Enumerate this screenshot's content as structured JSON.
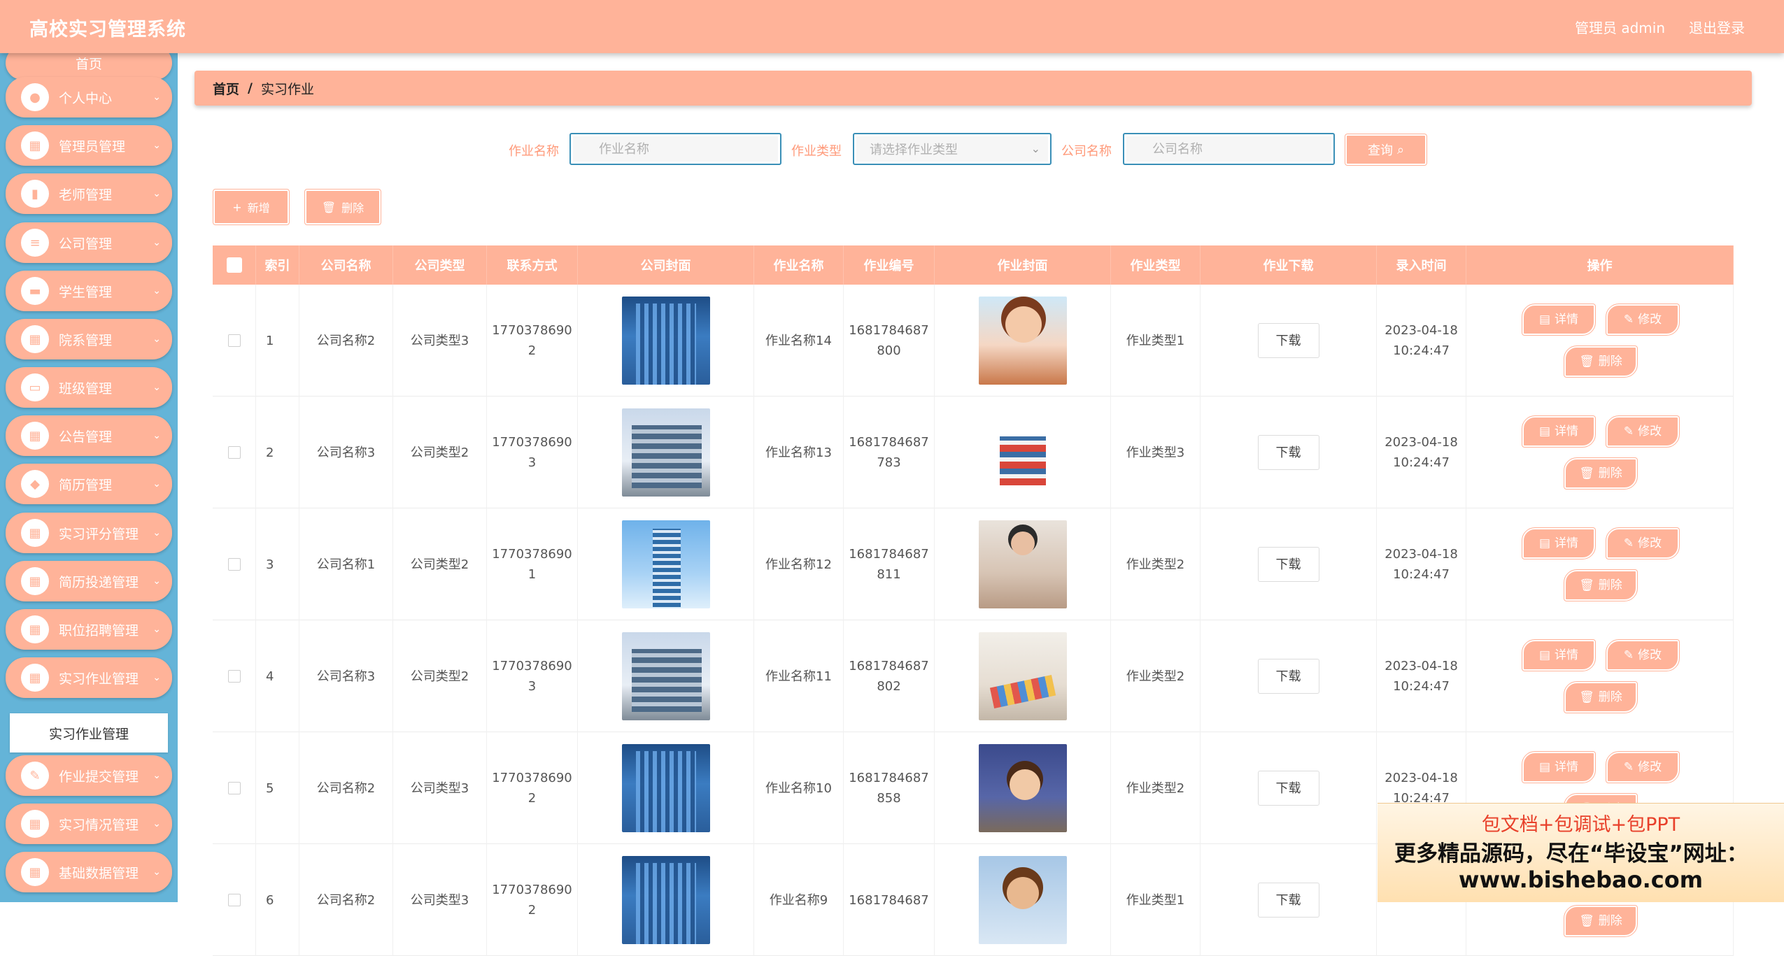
{
  "header": {
    "title": "高校实习管理系统",
    "user_label": "管理员 admin",
    "logout_label": "退出登录"
  },
  "sidebar": {
    "home_label": "首页",
    "items": [
      {
        "label": "个人中心",
        "icon": "person-icon"
      },
      {
        "label": "管理员管理",
        "icon": "grid-icon"
      },
      {
        "label": "老师管理",
        "icon": "bar-chart-icon"
      },
      {
        "label": "公司管理",
        "icon": "list-icon"
      },
      {
        "label": "学生管理",
        "icon": "sofa-icon"
      },
      {
        "label": "院系管理",
        "icon": "grid-icon"
      },
      {
        "label": "班级管理",
        "icon": "chat-icon"
      },
      {
        "label": "公告管理",
        "icon": "grid-icon"
      },
      {
        "label": "简历管理",
        "icon": "leaf-icon"
      },
      {
        "label": "实习评分管理",
        "icon": "grid-icon"
      },
      {
        "label": "简历投递管理",
        "icon": "grid-icon"
      },
      {
        "label": "职位招聘管理",
        "icon": "grid-icon"
      },
      {
        "label": "实习作业管理",
        "icon": "grid-icon"
      },
      {
        "label": "作业提交管理",
        "icon": "edit-icon"
      },
      {
        "label": "实习情况管理",
        "icon": "grid-icon"
      },
      {
        "label": "基础数据管理",
        "icon": "grid-icon"
      }
    ],
    "submenu_label": "实习作业管理"
  },
  "breadcrumb": {
    "home": "首页",
    "separator": "/",
    "current": "实习作业"
  },
  "search": {
    "homework_name_label": "作业名称",
    "homework_name_placeholder": "作业名称",
    "homework_type_label": "作业类型",
    "homework_type_placeholder": "请选择作业类型",
    "company_name_label": "公司名称",
    "company_name_placeholder": "公司名称",
    "query_label": "查询"
  },
  "actions": {
    "add_label": "新增",
    "delete_label": "删除"
  },
  "table": {
    "columns": [
      "索引",
      "公司名称",
      "公司类型",
      "联系方式",
      "公司封面",
      "作业名称",
      "作业编号",
      "作业封面",
      "作业类型",
      "作业下载",
      "录入时间",
      "操作"
    ],
    "download_label": "下载",
    "detail_label": "详情",
    "edit_label": "修改",
    "delete_label": "删除",
    "rows": [
      {
        "index": "1",
        "company": "公司名称2",
        "ctype": "公司类型3",
        "phone": "17703786902",
        "phone_a": "1770378690",
        "phone_b": "2",
        "cover": "building-a",
        "hw_name": "作业名称14",
        "hw_no_a": "1681784687",
        "hw_no_b": "800",
        "hw_cover": "hw1",
        "hw_type": "作业类型1",
        "date": "2023-04-18",
        "time": "10:24:47"
      },
      {
        "index": "2",
        "company": "公司名称3",
        "ctype": "公司类型2",
        "phone": "17703786903",
        "phone_a": "1770378690",
        "phone_b": "3",
        "cover": "building-b",
        "hw_name": "作业名称13",
        "hw_no_a": "1681784687",
        "hw_no_b": "783",
        "hw_cover": "hw2",
        "hw_type": "作业类型3",
        "date": "2023-04-18",
        "time": "10:24:47"
      },
      {
        "index": "3",
        "company": "公司名称1",
        "ctype": "公司类型2",
        "phone": "17703786901",
        "phone_a": "1770378690",
        "phone_b": "1",
        "cover": "building-c",
        "hw_name": "作业名称12",
        "hw_no_a": "1681784687",
        "hw_no_b": "811",
        "hw_cover": "hw3",
        "hw_type": "作业类型2",
        "date": "2023-04-18",
        "time": "10:24:47"
      },
      {
        "index": "4",
        "company": "公司名称3",
        "ctype": "公司类型2",
        "phone": "17703786903",
        "phone_a": "1770378690",
        "phone_b": "3",
        "cover": "building-b",
        "hw_name": "作业名称11",
        "hw_no_a": "1681784687",
        "hw_no_b": "802",
        "hw_cover": "hw4",
        "hw_type": "作业类型2",
        "date": "2023-04-18",
        "time": "10:24:47"
      },
      {
        "index": "5",
        "company": "公司名称2",
        "ctype": "公司类型3",
        "phone": "17703786902",
        "phone_a": "1770378690",
        "phone_b": "2",
        "cover": "building-a",
        "hw_name": "作业名称10",
        "hw_no_a": "1681784687",
        "hw_no_b": "858",
        "hw_cover": "hw5",
        "hw_type": "作业类型2",
        "date": "2023-04-18",
        "time": "10:24:47"
      },
      {
        "index": "6",
        "company": "公司名称2",
        "ctype": "公司类型3",
        "phone": "17703786902",
        "phone_a": "1770378690",
        "phone_b": "2",
        "cover": "building-a",
        "hw_name": "作业名称9",
        "hw_no_a": "1681784687",
        "hw_no_b": "",
        "hw_cover": "hw6",
        "hw_type": "作业类型1",
        "date": "",
        "time": ""
      }
    ]
  },
  "watermark": {
    "line1": "包文档+包调试+包PPT",
    "line2": "更多精品源码，尽在“毕设宝”网址：",
    "line3": "www.bishebao.com"
  },
  "colors": {
    "accent": "#ffb399",
    "sidebar_bg": "#64b4d8",
    "label": "#ff9a7a",
    "input_border": "#3a8fb7"
  }
}
